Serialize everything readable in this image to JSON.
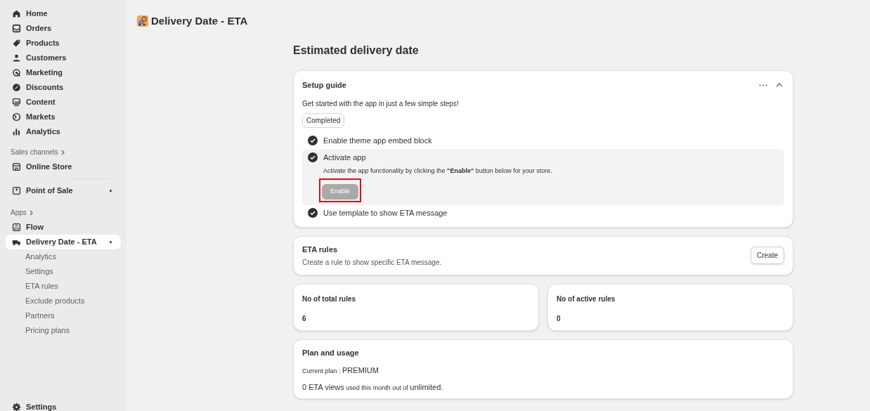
{
  "sidebar": {
    "items": [
      {
        "label": "Home",
        "dot": false,
        "selected": false
      },
      {
        "label": "Orders",
        "dot": false,
        "selected": false
      },
      {
        "label": "Products",
        "dot": false,
        "selected": false
      },
      {
        "label": "Customers",
        "dot": false,
        "selected": false
      },
      {
        "label": "Marketing",
        "dot": false,
        "selected": false
      },
      {
        "label": "Discounts",
        "dot": false,
        "selected": false
      },
      {
        "label": "Content",
        "dot": false,
        "selected": false
      },
      {
        "label": "Markets",
        "dot": false,
        "selected": false
      },
      {
        "label": "Analytics",
        "dot": false,
        "selected": false
      }
    ],
    "sales_channels": {
      "heading": "Sales channels",
      "items": [
        {
          "label": "Online Store",
          "dot": false,
          "selected": false
        },
        {
          "label": "Point of Sale",
          "dot": true,
          "selected": false
        }
      ]
    },
    "apps": {
      "heading": "Apps",
      "items": [
        {
          "label": "Flow",
          "dot": false,
          "selected": false
        },
        {
          "label": "Delivery Date - ETA",
          "dot": true,
          "selected": true,
          "children": [
            {
              "label": "Analytics",
              "selected": false
            },
            {
              "label": "Settings",
              "selected": false
            },
            {
              "label": "ETA rules",
              "selected": false
            },
            {
              "label": "Exclude products",
              "selected": false
            },
            {
              "label": "Partners",
              "selected": false
            },
            {
              "label": "Pricing plans",
              "selected": false
            }
          ]
        }
      ]
    },
    "settings": "Settings"
  },
  "header": {
    "title": "Delivery Date - ETA"
  },
  "page_title": "Estimated delivery date",
  "setup_guide": {
    "title": "Setup guide",
    "subtitle": "Get started with the app in just a few simple steps!",
    "badge": "Completed",
    "expanded": true,
    "steps": [
      {
        "label": "Enable theme app embed block",
        "done": true,
        "expanded": false
      },
      {
        "label": "Activate app",
        "done": true,
        "expanded": true,
        "description": "Activate the app functionality by clicking the **\"Enable\"** button below for your store.",
        "button": {
          "label": "Enable",
          "disabled": true,
          "highlighted": true
        }
      },
      {
        "label": "Use template to show ETA message",
        "done": true,
        "expanded": false
      }
    ]
  },
  "eta_rules": {
    "title": "ETA rules",
    "subtitle": "Create a rule to show specific ETA message.",
    "button": "Create"
  },
  "stats": [
    {
      "label": "No of total rules",
      "value": "6"
    },
    {
      "label": "No of active rules",
      "value": "0"
    }
  ],
  "plan": {
    "title": "Plan and usage",
    "lines": [
      [
        {
          "text": "Current plan : ",
          "emphasis": false
        },
        {
          "text": "PREMIUM",
          "emphasis": true
        }
      ],
      [
        {
          "text": "0 ETA views",
          "emphasis": true
        },
        {
          "text": " used this month out of ",
          "emphasis": false
        },
        {
          "text": "unlimited.",
          "emphasis": true
        }
      ]
    ]
  }
}
